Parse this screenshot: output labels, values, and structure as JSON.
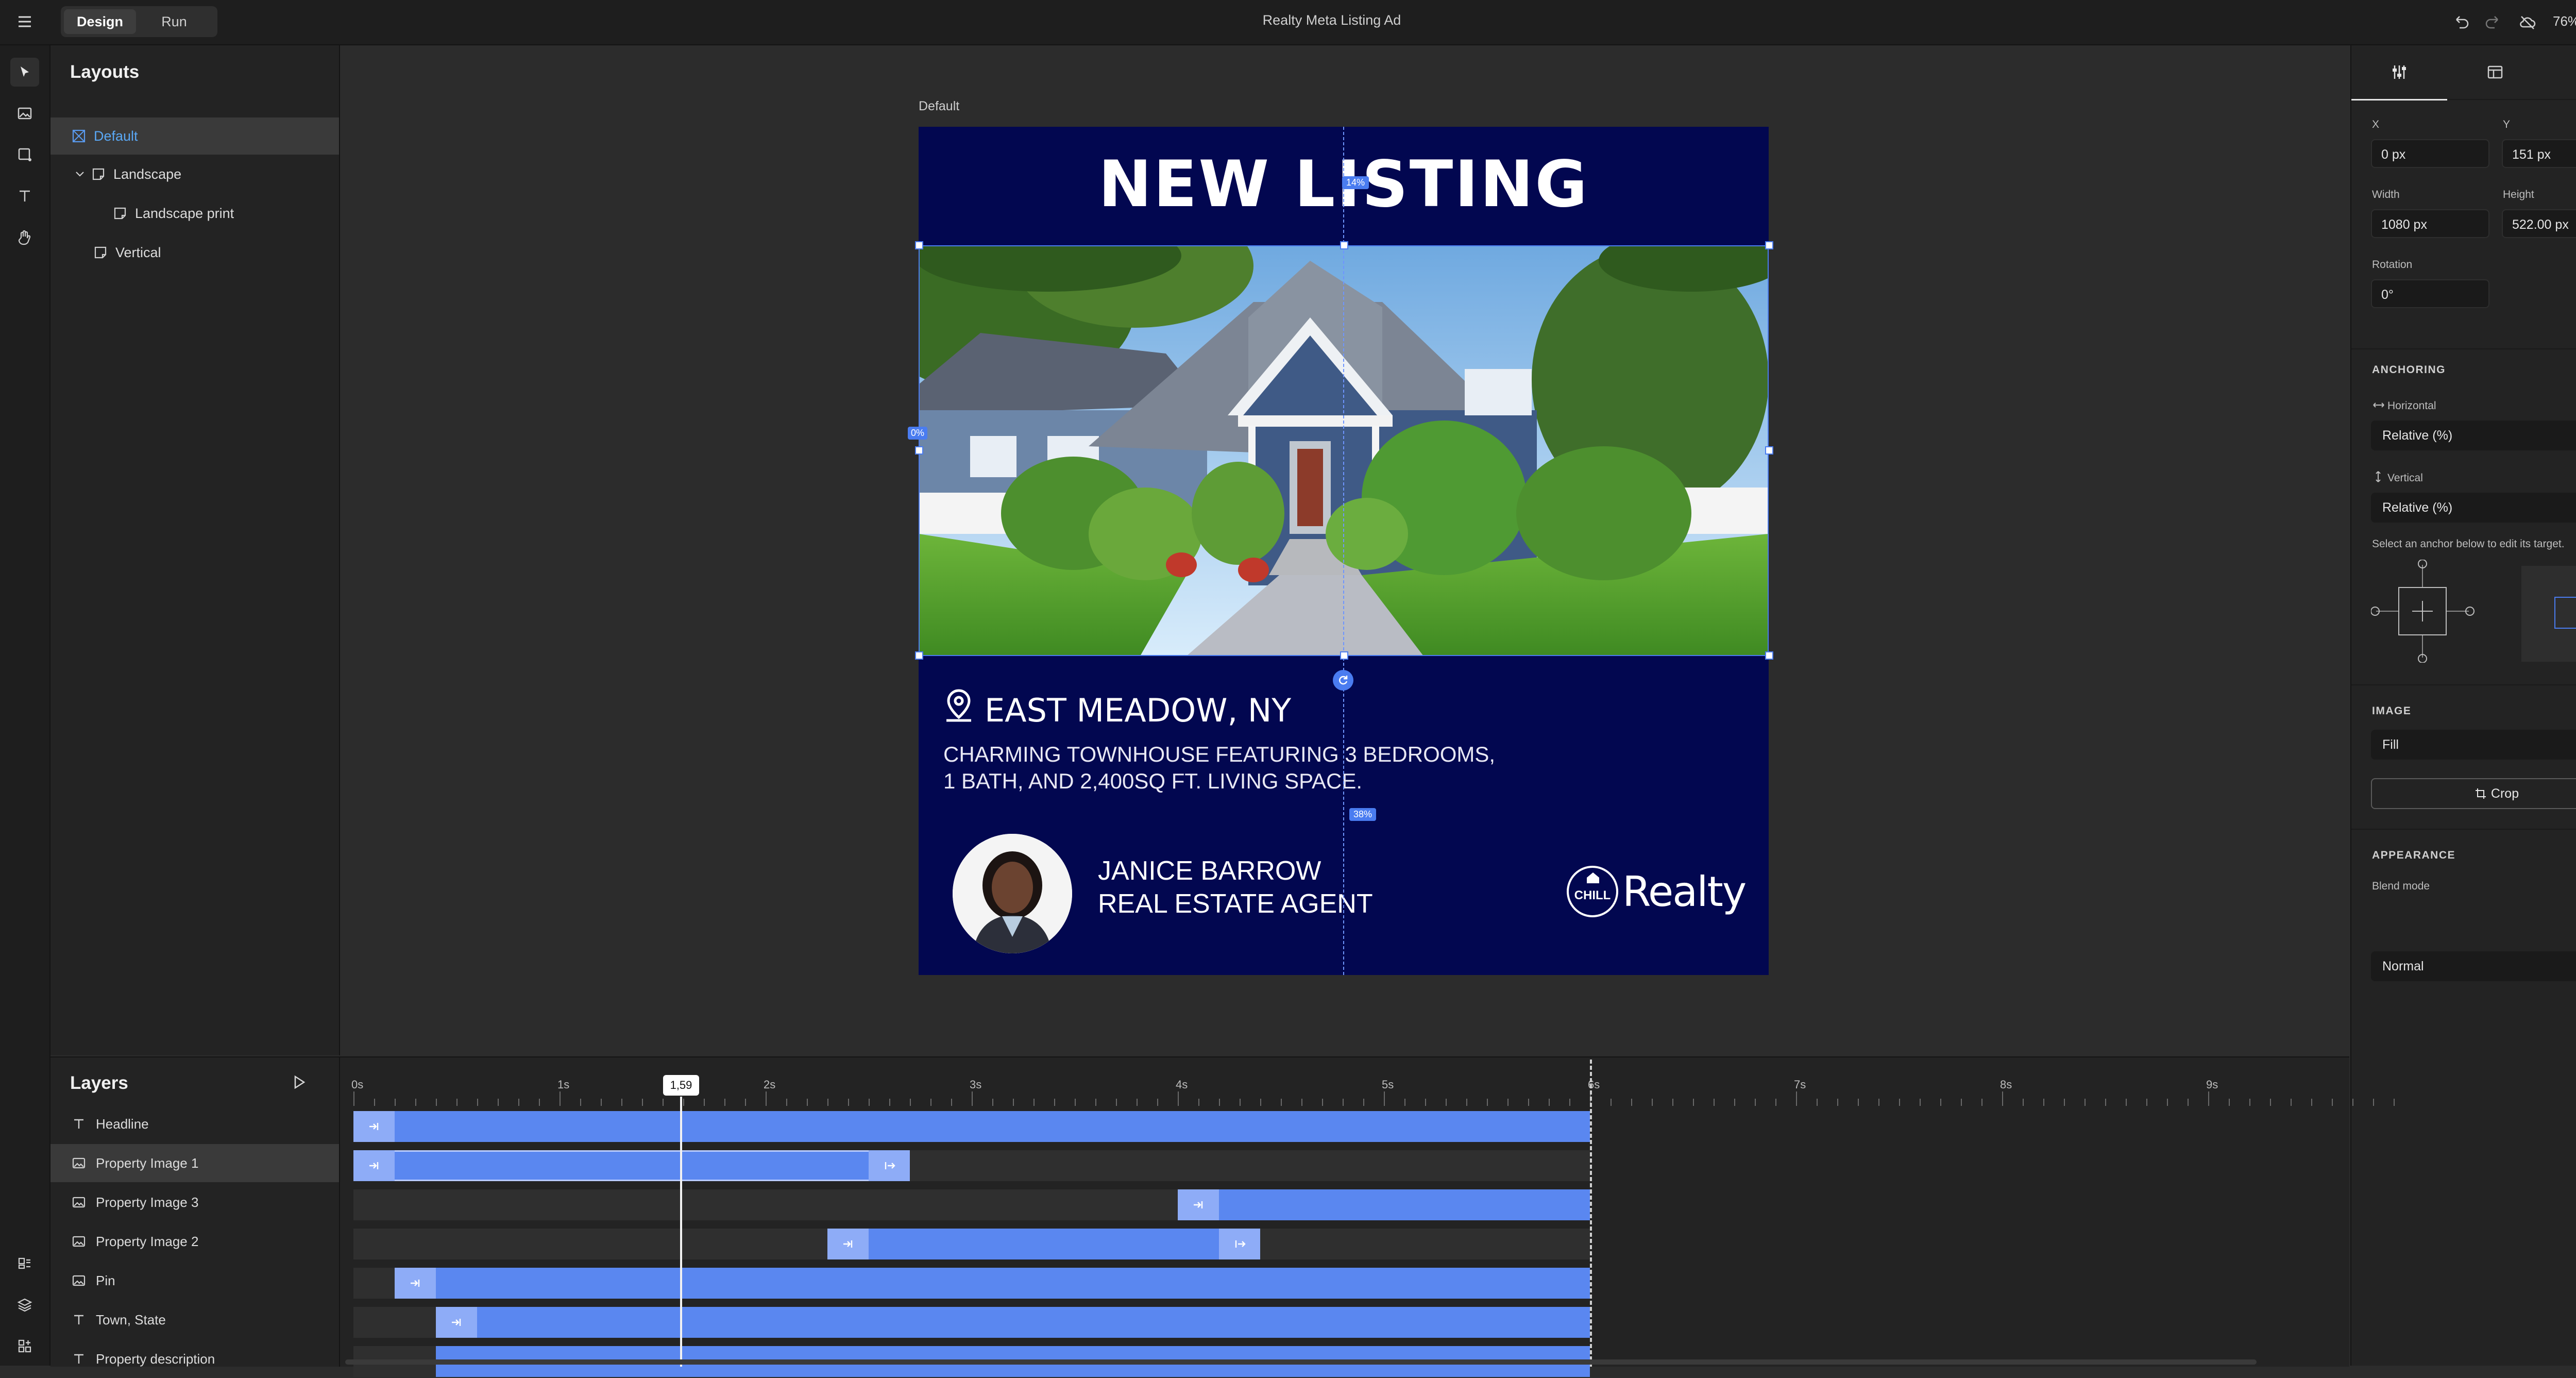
{
  "app": {
    "mode_tabs": [
      {
        "label": "Design",
        "active": true
      },
      {
        "label": "Run",
        "active": false
      }
    ],
    "title": "Realty Meta Listing Ad",
    "zoom": "76%"
  },
  "layouts": {
    "heading": "Layouts",
    "items": [
      {
        "label": "Default",
        "selected": true
      },
      {
        "label": "Landscape"
      },
      {
        "label": "Landscape print"
      },
      {
        "label": "Vertical"
      }
    ]
  },
  "canvas": {
    "artboard_label": "Default",
    "ad": {
      "headline": "NEW LISTING",
      "location": "EAST MEADOW, NY",
      "description_line1": "CHARMING TOWNHOUSE FEATURING 3 BEDROOMS,",
      "description_line2": "1 BATH, AND 2,400SQ FT. LIVING SPACE.",
      "agent_name": "JANICE BARROW",
      "agent_title": "REAL ESTATE AGENT",
      "logo_small": "CHILL",
      "logo_text": "Realty"
    },
    "guides": {
      "top_pct": "14%",
      "left_pct": "0%",
      "bottom_pct": "38%"
    }
  },
  "properties": {
    "x_label": "X",
    "x_value": "0 px",
    "y_label": "Y",
    "y_value": "151 px",
    "width_label": "Width",
    "width_value": "1080 px",
    "height_label": "Height",
    "height_value": "522.00 px",
    "rotation_label": "Rotation",
    "rotation_value": "0°",
    "anchoring_heading": "ANCHORING",
    "horizontal_label": "Horizontal",
    "horizontal_value": "Relative (%)",
    "vertical_label": "Vertical",
    "vertical_value": "Relative (%)",
    "anchor_hint": "Select an anchor below to edit its target.",
    "image_heading": "IMAGE",
    "image_fit": "Fill",
    "crop_label": "Crop",
    "appearance_heading": "APPEARANCE",
    "blend_label": "Blend mode",
    "blend_value": "Normal"
  },
  "layers": {
    "heading": "Layers",
    "items": [
      {
        "label": "Headline",
        "type": "text"
      },
      {
        "label": "Property Image 1",
        "type": "image",
        "selected": true
      },
      {
        "label": "Property Image 3",
        "type": "image"
      },
      {
        "label": "Property Image 2",
        "type": "image"
      },
      {
        "label": "Pin",
        "type": "image"
      },
      {
        "label": "Town, State",
        "type": "text"
      },
      {
        "label": "Property description",
        "type": "text"
      }
    ]
  },
  "timeline": {
    "ticks": [
      "0s",
      "1s",
      "2s",
      "3s",
      "4s",
      "5s",
      "6s",
      "7s",
      "8s",
      "9s"
    ],
    "playhead_label": "1,59",
    "playhead_seconds": 1.59,
    "end_seconds": 6.0,
    "bars": [
      {
        "start": 0.0,
        "end": 6.0,
        "in": true,
        "out": false
      },
      {
        "start": 0.0,
        "end": 2.7,
        "in": true,
        "out": true
      },
      {
        "start": 4.0,
        "end": 6.0,
        "in": true,
        "out": false
      },
      {
        "start": 2.3,
        "end": 4.4,
        "in": true,
        "out": true
      },
      {
        "start": 0.2,
        "end": 6.0,
        "in": true,
        "out": false
      },
      {
        "start": 0.4,
        "end": 6.0,
        "in": true,
        "out": false
      },
      {
        "start": 0.4,
        "end": 6.0,
        "in": false,
        "out": false
      }
    ]
  },
  "colors": {
    "accent": "#5a87f0",
    "artboard": "#020750",
    "selection": "#4a7cf0"
  }
}
